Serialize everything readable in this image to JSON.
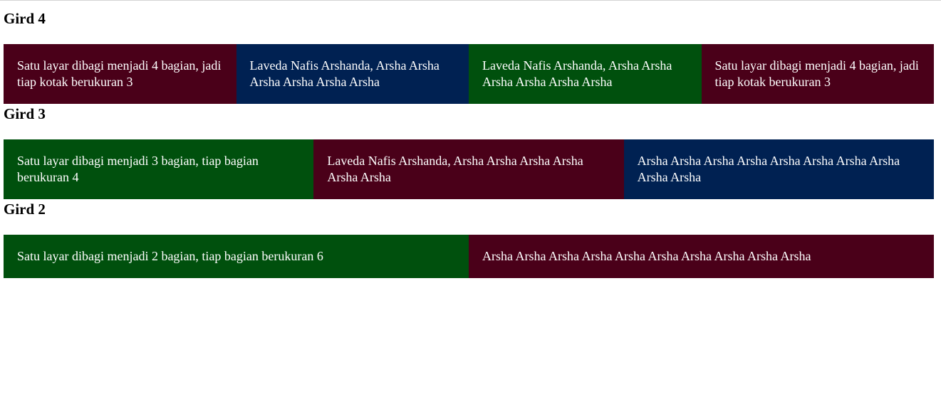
{
  "colors": {
    "maroon": "#4a0019",
    "navy": "#002152",
    "green": "#00500d"
  },
  "sections": [
    {
      "title": "Gird 4",
      "cells": [
        {
          "text": "Satu layar dibagi menjadi 4 bagian, jadi tiap kotak berukuran 3",
          "color": "maroon"
        },
        {
          "text": "Laveda Nafis Arshanda, Arsha Arsha Arsha Arsha Arsha Arsha",
          "color": "navy"
        },
        {
          "text": "Laveda Nafis Arshanda, Arsha Arsha Arsha Arsha Arsha Arsha",
          "color": "green"
        },
        {
          "text": "Satu layar dibagi menjadi 4 bagian, jadi tiap kotak berukuran 3",
          "color": "maroon"
        }
      ]
    },
    {
      "title": "Gird 3",
      "cells": [
        {
          "text": "Satu layar dibagi menjadi 3 bagian, tiap bagian berukuran 4",
          "color": "green"
        },
        {
          "text": "Laveda Nafis Arshanda, Arsha Arsha Arsha Arsha Arsha Arsha",
          "color": "maroon"
        },
        {
          "text": "Arsha Arsha Arsha Arsha Arsha Arsha Arsha Arsha Arsha Arsha",
          "color": "navy"
        }
      ]
    },
    {
      "title": "Gird 2",
      "cells": [
        {
          "text": "Satu layar dibagi menjadi 2 bagian, tiap bagian berukuran 6",
          "color": "green"
        },
        {
          "text": "Arsha Arsha Arsha Arsha Arsha Arsha Arsha Arsha Arsha Arsha",
          "color": "maroon"
        }
      ]
    }
  ]
}
